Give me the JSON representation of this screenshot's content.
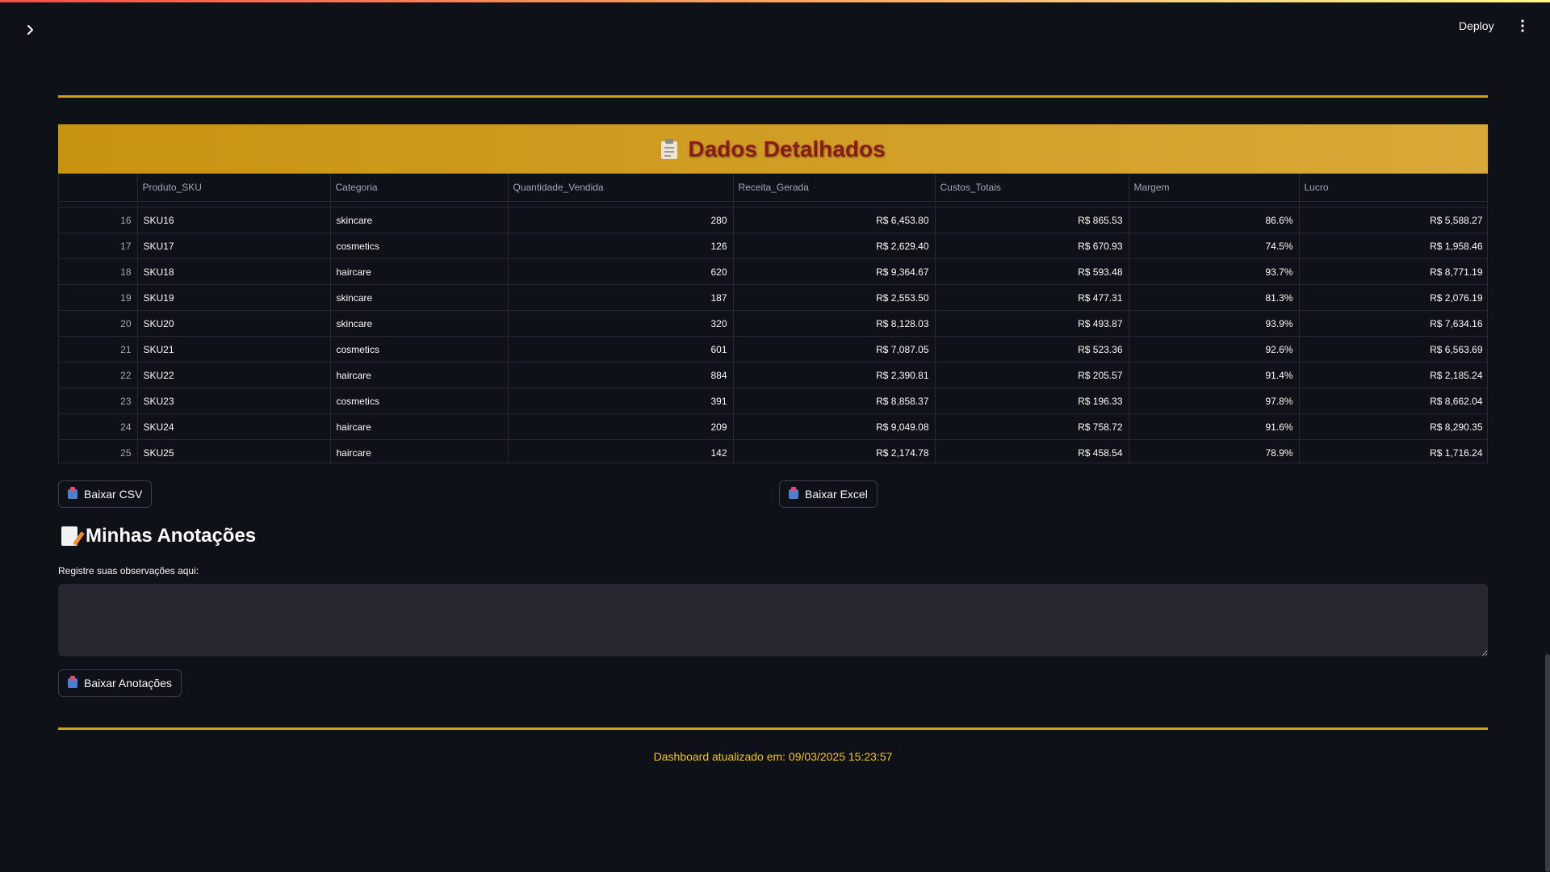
{
  "header": {
    "deploy_label": "Deploy",
    "sidebar_toggle_icon": "chevron-right-icon",
    "menu_icon": "kebab-menu-icon"
  },
  "colors": {
    "background": "#0e1117",
    "accent_gold": "#d4a017",
    "banner_title": "#8b1a1a",
    "footer_text": "#f5c518"
  },
  "table_section": {
    "title_icon": "clipboard-icon",
    "title": "Dados Detalhados",
    "columns": [
      "",
      "Produto_SKU",
      "Categoria",
      "Quantidade_Vendida",
      "Receita_Gerada",
      "Custos_Totais",
      "Margem",
      "Lucro"
    ],
    "rows": [
      {
        "idx": "16",
        "sku": "SKU16",
        "categoria": "skincare",
        "quantidade": "280",
        "receita": "R$ 6,453.80",
        "custos": "R$ 865.53",
        "margem": "86.6%",
        "lucro": "R$ 5,588.27"
      },
      {
        "idx": "17",
        "sku": "SKU17",
        "categoria": "cosmetics",
        "quantidade": "126",
        "receita": "R$ 2,629.40",
        "custos": "R$ 670.93",
        "margem": "74.5%",
        "lucro": "R$ 1,958.46"
      },
      {
        "idx": "18",
        "sku": "SKU18",
        "categoria": "haircare",
        "quantidade": "620",
        "receita": "R$ 9,364.67",
        "custos": "R$ 593.48",
        "margem": "93.7%",
        "lucro": "R$ 8,771.19"
      },
      {
        "idx": "19",
        "sku": "SKU19",
        "categoria": "skincare",
        "quantidade": "187",
        "receita": "R$ 2,553.50",
        "custos": "R$ 477.31",
        "margem": "81.3%",
        "lucro": "R$ 2,076.19"
      },
      {
        "idx": "20",
        "sku": "SKU20",
        "categoria": "skincare",
        "quantidade": "320",
        "receita": "R$ 8,128.03",
        "custos": "R$ 493.87",
        "margem": "93.9%",
        "lucro": "R$ 7,634.16"
      },
      {
        "idx": "21",
        "sku": "SKU21",
        "categoria": "cosmetics",
        "quantidade": "601",
        "receita": "R$ 7,087.05",
        "custos": "R$ 523.36",
        "margem": "92.6%",
        "lucro": "R$ 6,563.69"
      },
      {
        "idx": "22",
        "sku": "SKU22",
        "categoria": "haircare",
        "quantidade": "884",
        "receita": "R$ 2,390.81",
        "custos": "R$ 205.57",
        "margem": "91.4%",
        "lucro": "R$ 2,185.24"
      },
      {
        "idx": "23",
        "sku": "SKU23",
        "categoria": "cosmetics",
        "quantidade": "391",
        "receita": "R$ 8,858.37",
        "custos": "R$ 196.33",
        "margem": "97.8%",
        "lucro": "R$ 8,662.04"
      },
      {
        "idx": "24",
        "sku": "SKU24",
        "categoria": "haircare",
        "quantidade": "209",
        "receita": "R$ 9,049.08",
        "custos": "R$ 758.72",
        "margem": "91.6%",
        "lucro": "R$ 8,290.35"
      },
      {
        "idx": "25",
        "sku": "SKU25",
        "categoria": "haircare",
        "quantidade": "142",
        "receita": "R$ 2,174.78",
        "custos": "R$ 458.54",
        "margem": "78.9%",
        "lucro": "R$ 1,716.24"
      }
    ]
  },
  "downloads": {
    "csv_label": "Baixar CSV",
    "excel_label": "Baixar Excel",
    "icon": "inbox-tray-icon"
  },
  "notes": {
    "title_icon": "memo-icon",
    "title": "Minhas Anotações",
    "field_label": "Registre suas observações aqui:",
    "value": "",
    "download_label": "Baixar Anotações"
  },
  "footer": {
    "text": "Dashboard atualizado em: 09/03/2025 15:23:57"
  }
}
